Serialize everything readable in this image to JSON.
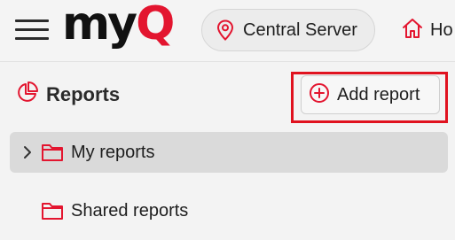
{
  "header": {
    "logo_my": "my",
    "logo_q": "Q",
    "server_label": "Central Server",
    "home_label": "Ho"
  },
  "reports": {
    "title": "Reports",
    "add_button_label": "Add report",
    "items": [
      {
        "label": "My reports",
        "expandable": true,
        "selected": true
      },
      {
        "label": "Shared reports",
        "expandable": false,
        "selected": false
      }
    ]
  },
  "colors": {
    "brand_red": "#e3152f",
    "highlight_red": "#e0121f",
    "selected_bg": "#dadada"
  },
  "icons": {
    "menu": "hamburger-icon",
    "server": "map-pin-icon",
    "home": "home-icon",
    "reports": "pie-chart-icon",
    "add": "plus-circle-icon",
    "expand": "chevron-right-icon",
    "folder": "folder-icon"
  }
}
